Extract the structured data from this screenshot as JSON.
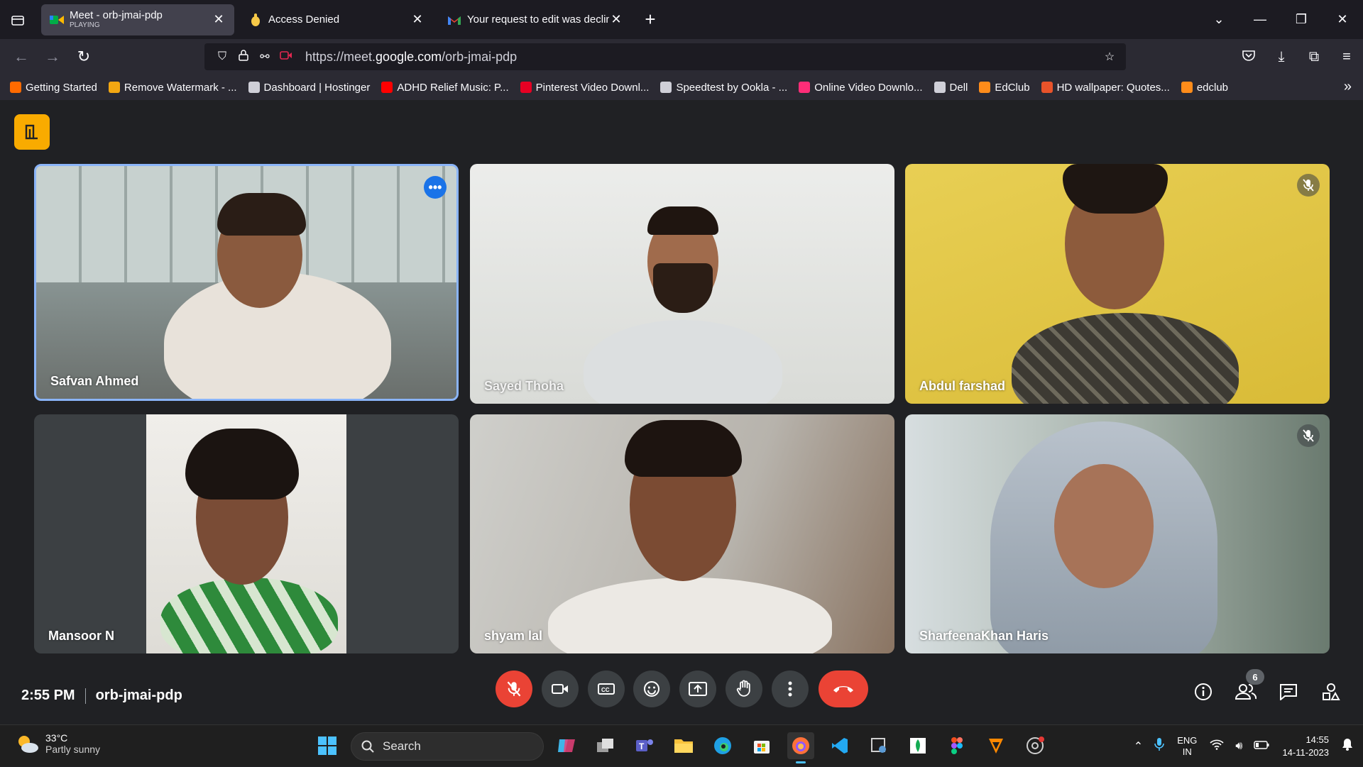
{
  "browser": {
    "tabs": [
      {
        "title": "Meet - orb-jmai-pdp",
        "subtitle": "PLAYING",
        "active": true
      },
      {
        "title": "Access Denied",
        "subtitle": "",
        "active": false
      },
      {
        "title": "Your request to edit was decline",
        "subtitle": "",
        "active": false
      }
    ],
    "url_prefix": "https://meet.",
    "url_domain": "google.com",
    "url_path": "/orb-jmai-pdp",
    "bookmarks": [
      {
        "label": "Getting Started",
        "color": "#ff6a00"
      },
      {
        "label": "Remove Watermark - ...",
        "color": "#f3a712"
      },
      {
        "label": "Dashboard | Hostinger",
        "color": "#cfcfd8"
      },
      {
        "label": "ADHD Relief Music: P...",
        "color": "#ff0000"
      },
      {
        "label": "Pinterest Video Downl...",
        "color": "#e60023"
      },
      {
        "label": "Speedtest by Ookla - ...",
        "color": "#cfcfd8"
      },
      {
        "label": "Online Video Downlo...",
        "color": "#ff2d78"
      },
      {
        "label": "Dell",
        "color": "#cfcfd8"
      },
      {
        "label": "EdClub",
        "color": "#ff8c1a"
      },
      {
        "label": "HD wallpaper: Quotes...",
        "color": "#e8532a"
      },
      {
        "label": "edclub",
        "color": "#ff8c1a"
      }
    ]
  },
  "meet": {
    "participants": [
      {
        "name": "Safvan Ahmed",
        "muted": false,
        "active_speaker": true
      },
      {
        "name": "Sayed Thoha",
        "muted": false,
        "active_speaker": false
      },
      {
        "name": "Abdul farshad",
        "muted": true,
        "active_speaker": false
      },
      {
        "name": "Mansoor N",
        "muted": false,
        "active_speaker": false
      },
      {
        "name": "shyam lal",
        "muted": false,
        "active_speaker": false
      },
      {
        "name": "SharfeenaKhan Haris",
        "muted": true,
        "active_speaker": false
      }
    ],
    "time": "2:55 PM",
    "meeting_code": "orb-jmai-pdp",
    "people_count": "6"
  },
  "taskbar": {
    "temperature": "33°C",
    "weather": "Partly sunny",
    "search_label": "Search",
    "lang_top": "ENG",
    "lang_bottom": "IN",
    "time": "14:55",
    "date": "14-11-2023"
  },
  "colors": {
    "accent": "#1a73e8",
    "danger": "#ea4335",
    "logo": "#f9ab00"
  }
}
